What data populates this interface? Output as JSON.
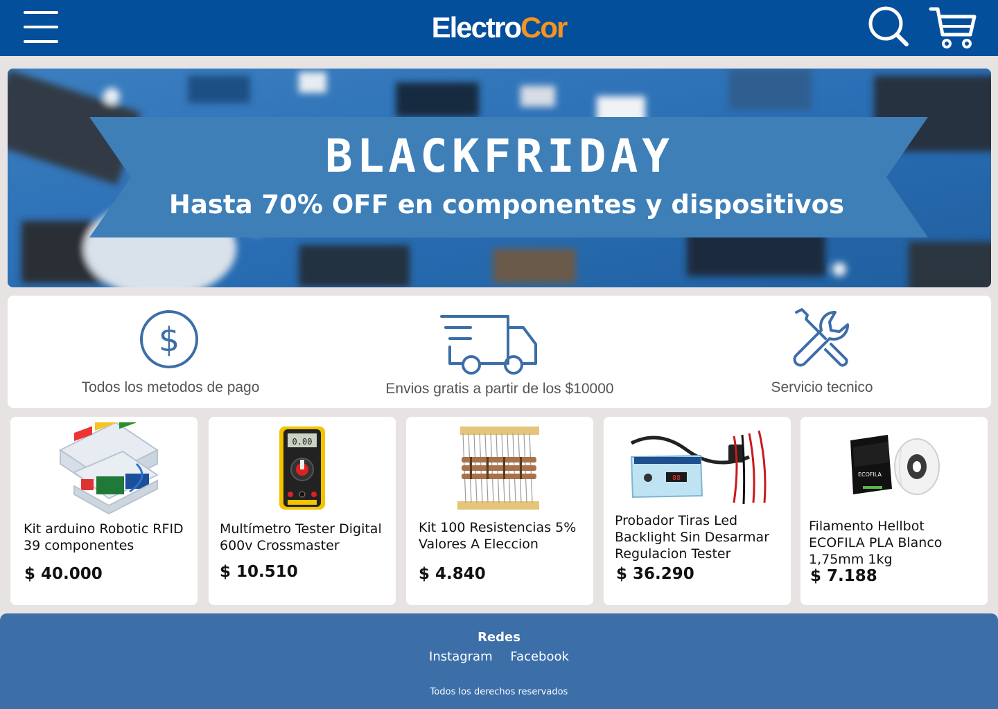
{
  "header": {
    "logo_part1": "Electro",
    "logo_part2": "Cor",
    "menu_icon": "hamburger-menu-icon",
    "search_icon": "search-icon",
    "cart_icon": "shopping-cart-icon",
    "bg_color": "#034f9c"
  },
  "banner": {
    "title": "BLACKFRIDAY",
    "subtitle": "Hasta 70% OFF en componentes  y dispositivos",
    "ribbon_color": "#3e7fb8"
  },
  "features": [
    {
      "label": "Todos los metodos de pago",
      "icon": "dollar-coin-icon"
    },
    {
      "label": "Envios gratis a partir de los $10000",
      "icon": "delivery-truck-icon"
    },
    {
      "label": "Servicio tecnico",
      "icon": "tools-icon"
    }
  ],
  "products": [
    {
      "title": "Kit arduino Robotic RFID 39 componentes",
      "price": "$ 40.000"
    },
    {
      "title": "Multímetro Tester Digital 600v Crossmaster",
      "price": "$ 10.510"
    },
    {
      "title": "Kit 100 Resistencias 5% Valores A Eleccion",
      "price": "$ 4.840"
    },
    {
      "title": "Probador Tiras Led Backlight Sin Desarmar Regulacion Tester",
      "price": "$ 36.290"
    },
    {
      "title": "Filamento Hellbot ECOFILA PLA Blanco 1,75mm 1kg",
      "price": "$ 7.188"
    }
  ],
  "footer": {
    "title": "Redes",
    "links": [
      "Instagram",
      "Facebook"
    ],
    "copyright": "Todos los derechos reservados",
    "bg_color": "#3c6ea8"
  }
}
